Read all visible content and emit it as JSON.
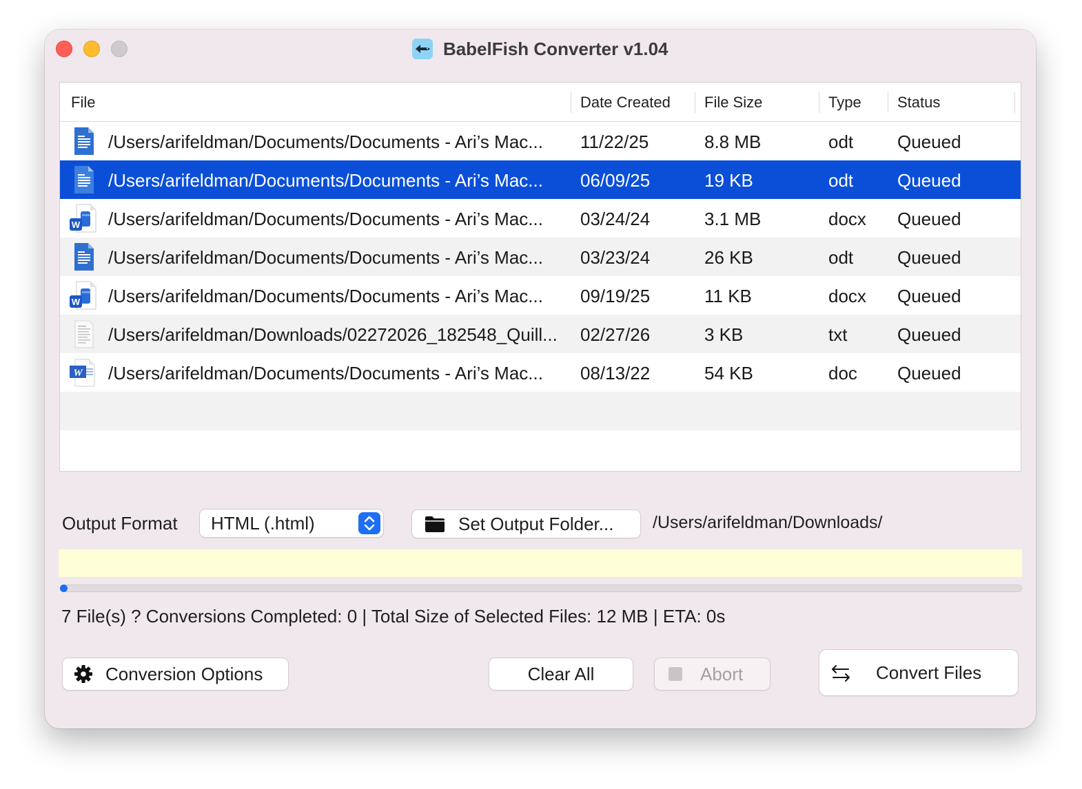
{
  "window": {
    "title": "BabelFish Converter v1.04"
  },
  "table": {
    "columns": [
      "File",
      "Date Created",
      "File Size",
      "Type",
      "Status"
    ],
    "rows": [
      {
        "icon": "odt-document-icon",
        "file": "/Users/arifeldman/Documents/Documents - Ari’s Mac...",
        "date": "11/22/25",
        "size": "8.8 MB",
        "type": "odt",
        "status": "Queued"
      },
      {
        "icon": "odt-document-icon",
        "file": "/Users/arifeldman/Documents/Documents - Ari’s Mac...",
        "date": "06/09/25",
        "size": "19 KB",
        "type": "odt",
        "status": "Queued"
      },
      {
        "icon": "word-docx-icon",
        "file": "/Users/arifeldman/Documents/Documents - Ari’s Mac...",
        "date": "03/24/24",
        "size": "3.1 MB",
        "type": "docx",
        "status": "Queued"
      },
      {
        "icon": "odt-document-icon",
        "file": "/Users/arifeldman/Documents/Documents - Ari’s Mac...",
        "date": "03/23/24",
        "size": "26 KB",
        "type": "odt",
        "status": "Queued"
      },
      {
        "icon": "word-docx-icon",
        "file": "/Users/arifeldman/Documents/Documents - Ari’s Mac...",
        "date": "09/19/25",
        "size": "11 KB",
        "type": "docx",
        "status": "Queued"
      },
      {
        "icon": "text-file-icon",
        "file": "/Users/arifeldman/Downloads/02272026_182548_Quill...",
        "date": "02/27/26",
        "size": "3 KB",
        "type": "txt",
        "status": "Queued"
      },
      {
        "icon": "word-doc-icon",
        "file": "/Users/arifeldman/Documents/Documents - Ari’s Mac...",
        "date": "08/13/22",
        "size": "54 KB",
        "type": "doc",
        "status": "Queued"
      }
    ]
  },
  "output": {
    "format_label": "Output Format",
    "format_value": "HTML (.html)",
    "folder_button": "Set Output Folder...",
    "folder_path": "/Users/arifeldman/Downloads/"
  },
  "progress": {
    "fraction": 0
  },
  "status_line": "7 File(s) ? Conversions Completed: 0 | Total Size of Selected Files: 12 MB | ETA: 0s",
  "buttons": {
    "conversion_options": "Conversion Options",
    "clear_all": "Clear All",
    "abort": "Abort",
    "convert_files": "Convert Files"
  },
  "colors": {
    "selection": "#0b4fd8",
    "accent": "#1a6df4",
    "message_bar": "#fdfdd7"
  }
}
